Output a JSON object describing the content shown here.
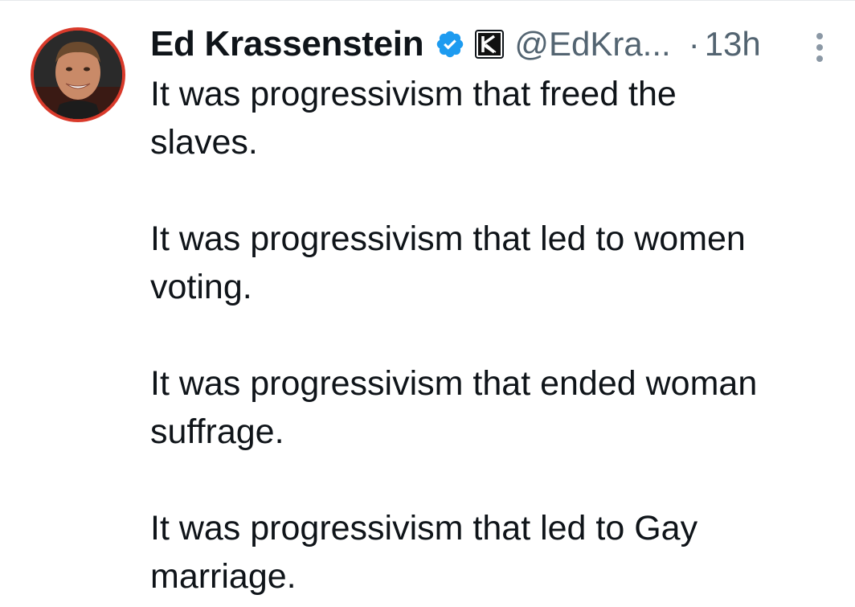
{
  "tweet": {
    "author": {
      "display_name": "Ed Krassenstein",
      "handle": "@EdKra...",
      "verified_icon": "verified-badge-icon",
      "affiliate_icon": "affiliate-logo-icon",
      "avatar_icon": "profile-avatar"
    },
    "separator": "·",
    "timestamp": "13h",
    "paragraphs": [
      {
        "line1": "It was progressivism that freed the",
        "line2": "slaves."
      },
      {
        "line1": "It was progressivism that led to women",
        "line2": "voting."
      },
      {
        "line1": "It was progressivism that ended woman",
        "line2": "suffrage."
      },
      {
        "line1": "It was progressivism that led to Gay",
        "line2": "marriage."
      }
    ],
    "more_icon": "more-options-icon"
  },
  "colors": {
    "text_primary": "#0f1419",
    "text_secondary": "#536471",
    "verified_blue": "#1d9bf0",
    "avatar_ring": "#d93a2b"
  }
}
